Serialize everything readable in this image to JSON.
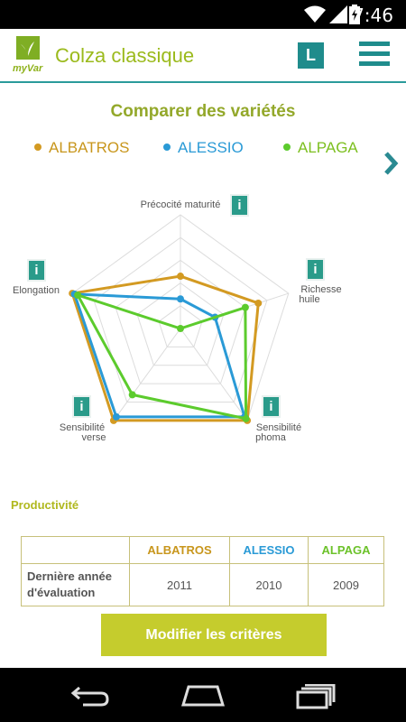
{
  "status": {
    "time": "7:46"
  },
  "app": {
    "brand": "myVar",
    "title": "Colza classique",
    "letter_button": "L"
  },
  "section": {
    "title": "Comparer des variétés"
  },
  "legend": [
    {
      "name": "ALBATROS",
      "color": "#d39a22"
    },
    {
      "name": "ALESSIO",
      "color": "#2a9ad6"
    },
    {
      "name": "ALPAGA",
      "color": "#5ccb2d"
    }
  ],
  "chart_data": {
    "type": "radar",
    "axes": [
      "Précocité maturité",
      "Richesse huile",
      "Sensibilité phoma",
      "Sensibilité verse",
      "Elongation"
    ],
    "max": 1,
    "series": [
      {
        "name": "ALBATROS",
        "values": [
          0.46,
          0.72,
          1.0,
          1.0,
          1.0
        ]
      },
      {
        "name": "ALESSIO",
        "values": [
          0.26,
          0.32,
          0.96,
          0.96,
          0.98
        ]
      },
      {
        "name": "ALPAGA",
        "values": [
          0.0,
          0.6,
          0.98,
          0.72,
          0.95
        ]
      }
    ]
  },
  "chart_labels": {
    "precocite": "Précocité maturité",
    "richesse_1": "Richesse",
    "richesse_2": "huile",
    "phoma_1": "Sensibilité",
    "phoma_2": "phoma",
    "verse_1": "Sensibilité",
    "verse_2": "verse",
    "elongation": "Elongation"
  },
  "info_label": "i",
  "productivite": "Productivité",
  "table": {
    "headers": [
      "",
      "ALBATROS",
      "ALESSIO",
      "ALPAGA"
    ],
    "row_label": "Dernière année d'évaluation",
    "values": [
      "2011",
      "2010",
      "2009"
    ]
  },
  "modify_button": "Modifier les critères"
}
